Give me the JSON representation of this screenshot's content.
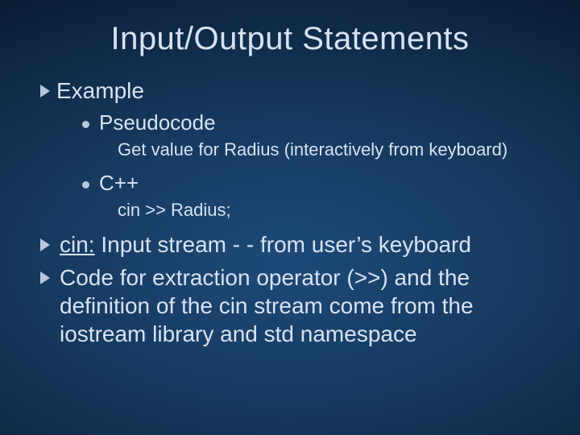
{
  "title": "Input/Output Statements",
  "bullet1": "Example",
  "sub1": "Pseudocode",
  "sub1_detail": "Get value for Radius (interactively from keyboard)",
  "sub2": "C++",
  "sub2_detail": "cin >> Radius;",
  "bullet2_lead": "cin:",
  "bullet2_rest": " Input stream  - - from user’s keyboard",
  "bullet3": "Code for extraction operator (>>) and the definition of the cin stream come from the iostream library and std namespace"
}
